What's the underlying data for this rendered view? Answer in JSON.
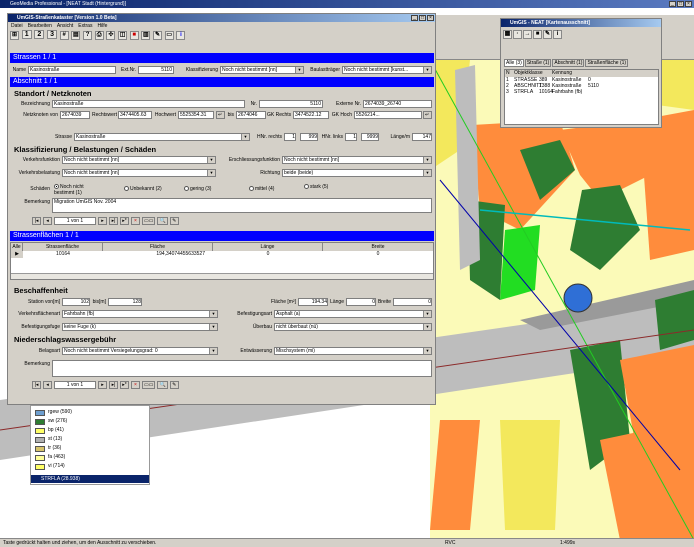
{
  "desktop": {
    "title": "GeoMedia Professional - [NEAT Stadt (Hintergrund)]",
    "status_left": "Taste gedrückt halten und ziehen, um den Ausschnitt zu verschieben.",
    "status_mid": "RVC",
    "status_right": "1:499s"
  },
  "main_window": {
    "title": "UmGIS-Straßenkataster [Version 1.0 Beta]",
    "menu": [
      "Datei",
      "Bearbeiten",
      "Ansicht",
      "Extras",
      "Hilfe"
    ],
    "toolbar_nums": [
      "1",
      "2",
      "3"
    ],
    "strassen": {
      "header": "Strassen 1 / 1",
      "name_label": "Name",
      "name_value": "Kasinostraße",
      "extnr_label": "Ext.Nr.",
      "extnr_value": "5110",
      "klass_label": "Klassifizierung",
      "klass_value": "Noch nicht bestimmt [nn]",
      "bl_label": "Baulastträger",
      "bl_value": "Noch nicht bestimmt [kunst..."
    },
    "abschnitt": {
      "header": "Abschnitt 1 / 1",
      "sec1": "Standort / Netzknoten",
      "bez_label": "Bezeichnung",
      "bez_value": "Kasinostraße",
      "nr_label": "Nr.",
      "nr_value": "5110",
      "ext_label": "Externe Nr.",
      "ext_value": "2674039_26740",
      "von_label": "Netzknoten von",
      "von_value": "2674039",
      "r1_label": "Rechtswert",
      "r1_value": "3474405.63",
      "h1_label": "Hochwert",
      "h1_value": "5525354.31",
      "bis_label": "bis",
      "bis_value": "2674046",
      "gkr_label": "GK Rechts",
      "gkr_value": "3474522.12",
      "gkh_label": "GK Hoch",
      "gkh_value": "5526214...",
      "strasse_label": "Strasse",
      "strasse_value": "Kasinostraße",
      "hnr_label": "HNr. rechts",
      "hnr1": "1",
      "hnr2": "999",
      "hnl_label": "HNr. links",
      "hnl1": "1",
      "hnl2": "9999",
      "laenge_label": "Länge/m",
      "laenge_value": "147",
      "sec2": "Klassifizierung / Belastungen / Schäden",
      "vf_label": "Verkehrsfunktion",
      "vf_value": "Noch nicht bestimmt [nn]",
      "ef_label": "Erschliessungsfunktion",
      "ef_value": "Noch nicht bestimmt [nn]",
      "vb_label": "Verkehrsbelastung",
      "vb_value": "Noch nicht bestimmt [nn]",
      "ri_label": "Richtung",
      "ri_value": "beide (beide)",
      "sch_label": "Schäden",
      "radios": [
        "Noch nicht bestimmt (1)",
        "Unbekannt (2)",
        "gering (3)",
        "mittel (4)",
        "stark (5)"
      ],
      "bem_label": "Bemerkung",
      "bem_value": "Migration UmGIS Nov. 2004",
      "nav_count": "1 von 1"
    },
    "flaechen": {
      "header": "Strassenflächen 1 / 1",
      "cols": [
        "Alle",
        "Strassenfläche",
        "Fläche",
        "Länge",
        "Breite"
      ],
      "row": [
        "10164",
        "194,34074455633527",
        "0",
        "0"
      ],
      "sec3": "Beschaffenheit",
      "stat_label": "Station von[m]",
      "stat_from": "102",
      "stat_bis_label": "bis[m]",
      "stat_to": "128",
      "fl_label": "Fläche [m²]",
      "fl_value": "194.34",
      "la_label": "Länge",
      "la_value": "0",
      "br_label": "Breite",
      "br_value": "0",
      "vfa_label": "Verkehrsflächenart",
      "vfa_value": "Fahrbahn (fb)",
      "bg_label": "Befestigungsart",
      "bg_value": "Asphalt (a)",
      "bf_label": "Befestigungsfuge",
      "bf_value": "keine Fuge (k)",
      "ub_label": "Überbau",
      "ub_value": "nicht überbaut (nü)",
      "sec4": "Niederschlagswassergebühr",
      "bel_label": "Belagsart",
      "bel_value": "Noch nicht bestimmt Versiegelungsgrad: 0",
      "ent_label": "Entwässerung",
      "ent_value": "Mischsystem (mi)",
      "bem_label": "Bemerkung",
      "nav_count": "1 von 1"
    }
  },
  "right_panel": {
    "title": "UmGIS - NEAT [Kartenausschnitt]",
    "tabs": [
      "Alle (3)",
      "Straße (1)",
      "Abschnitt (1)",
      "Straßenfläche (1)"
    ],
    "cols": [
      "N",
      "Objektklasse",
      "Kennung"
    ],
    "rows": [
      [
        "1",
        "STRASSE",
        "389",
        "Kasinostraße",
        "0"
      ],
      [
        "2",
        "ABSCHNITT",
        "1388",
        "Kasinostraße",
        "5110"
      ],
      [
        "3",
        "STRFLA",
        "10164",
        "Fahrbahn (fb)",
        ""
      ]
    ]
  },
  "legend": {
    "items": [
      {
        "label": "rgew (590)",
        "color": "#6e9fd0"
      },
      {
        "label": "sw (276)",
        "color": "#2e7d32"
      },
      {
        "label": "bp (41)",
        "color": "#ffff66"
      },
      {
        "label": "st (13)",
        "color": "#b0b0b0"
      },
      {
        "label": "tr (36)",
        "color": "#d6c36a"
      },
      {
        "label": "fa (463)",
        "color": "#ffff99"
      },
      {
        "label": "vi (714)",
        "color": "#ffff66"
      }
    ],
    "selected": "STRFLA (28.938)"
  }
}
